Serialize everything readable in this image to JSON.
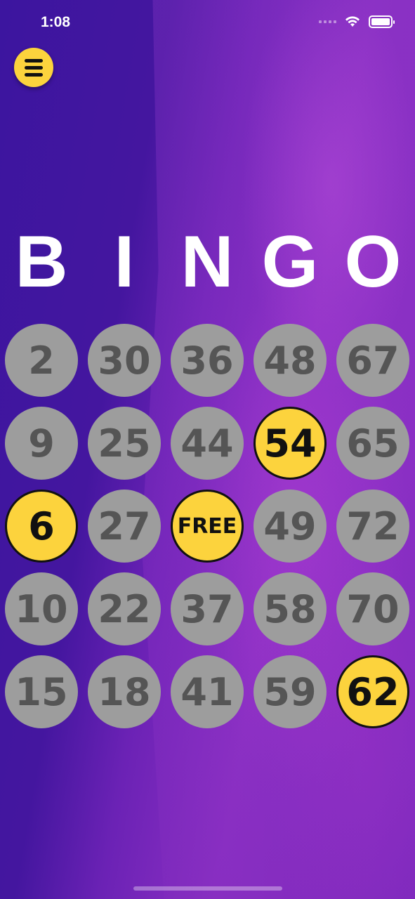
{
  "status_bar": {
    "time": "1:08"
  },
  "header": {
    "menu_icon": "hamburger-menu-icon"
  },
  "title_letters": [
    "B",
    "I",
    "N",
    "G",
    "O"
  ],
  "board": {
    "rows": [
      [
        {
          "label": "2",
          "marked": false
        },
        {
          "label": "30",
          "marked": false
        },
        {
          "label": "36",
          "marked": false
        },
        {
          "label": "48",
          "marked": false
        },
        {
          "label": "67",
          "marked": false
        }
      ],
      [
        {
          "label": "9",
          "marked": false
        },
        {
          "label": "25",
          "marked": false
        },
        {
          "label": "44",
          "marked": false
        },
        {
          "label": "54",
          "marked": true
        },
        {
          "label": "65",
          "marked": false
        }
      ],
      [
        {
          "label": "6",
          "marked": true
        },
        {
          "label": "27",
          "marked": false
        },
        {
          "label": "FREE",
          "marked": true
        },
        {
          "label": "49",
          "marked": false
        },
        {
          "label": "72",
          "marked": false
        }
      ],
      [
        {
          "label": "10",
          "marked": false
        },
        {
          "label": "22",
          "marked": false
        },
        {
          "label": "37",
          "marked": false
        },
        {
          "label": "58",
          "marked": false
        },
        {
          "label": "70",
          "marked": false
        }
      ],
      [
        {
          "label": "15",
          "marked": false
        },
        {
          "label": "18",
          "marked": false
        },
        {
          "label": "41",
          "marked": false
        },
        {
          "label": "59",
          "marked": false
        },
        {
          "label": "62",
          "marked": true
        }
      ]
    ]
  },
  "colors": {
    "marked": "#fcd33d",
    "unmarked": "#9d9d9d",
    "background": "#3f15a3"
  }
}
